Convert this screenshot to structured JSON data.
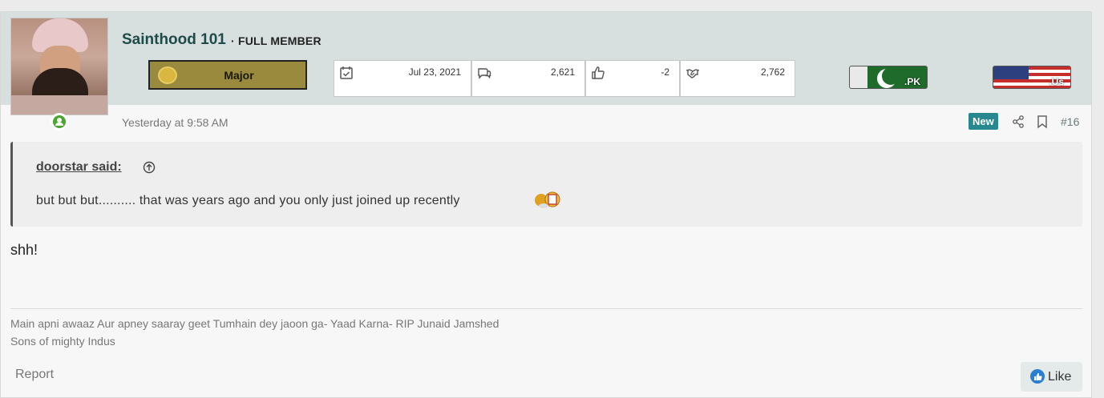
{
  "user": {
    "name": "Sainthood 101",
    "title": "· FULL MEMBER",
    "rank": "Major",
    "online_status_icon": "user-online-icon"
  },
  "stats": [
    {
      "icon": "calendar-check-icon",
      "value": "Jul 23, 2021"
    },
    {
      "icon": "messages-icon",
      "value": "2,621"
    },
    {
      "icon": "thumbs-up-icon",
      "value": "-2"
    },
    {
      "icon": "handshake-icon",
      "value": "2,762"
    }
  ],
  "flags": [
    {
      "name": "pakistan-flag",
      "label": ".PK"
    },
    {
      "name": "usa-flag",
      "label": ".Us"
    }
  ],
  "post": {
    "time": "Yesterday at 9:58 AM",
    "badge": "New",
    "number": "#16",
    "body": "shh!"
  },
  "quote": {
    "author": "doorstar said:",
    "text": "but but but.......... that was years ago and you only just joined up recently"
  },
  "signature": {
    "line1": "Main apni awaaz Aur apney saaray geet Tumhain dey jaoon ga- Yaad Karna- RIP Junaid Jamshed",
    "line2": "Sons of mighty Indus"
  },
  "actions": {
    "report": "Report",
    "like": "Like"
  },
  "colors": {
    "header_bg": "#d7e0df",
    "accent": "#27898f",
    "username": "#1f4a4a",
    "online": "#4aa52e"
  }
}
